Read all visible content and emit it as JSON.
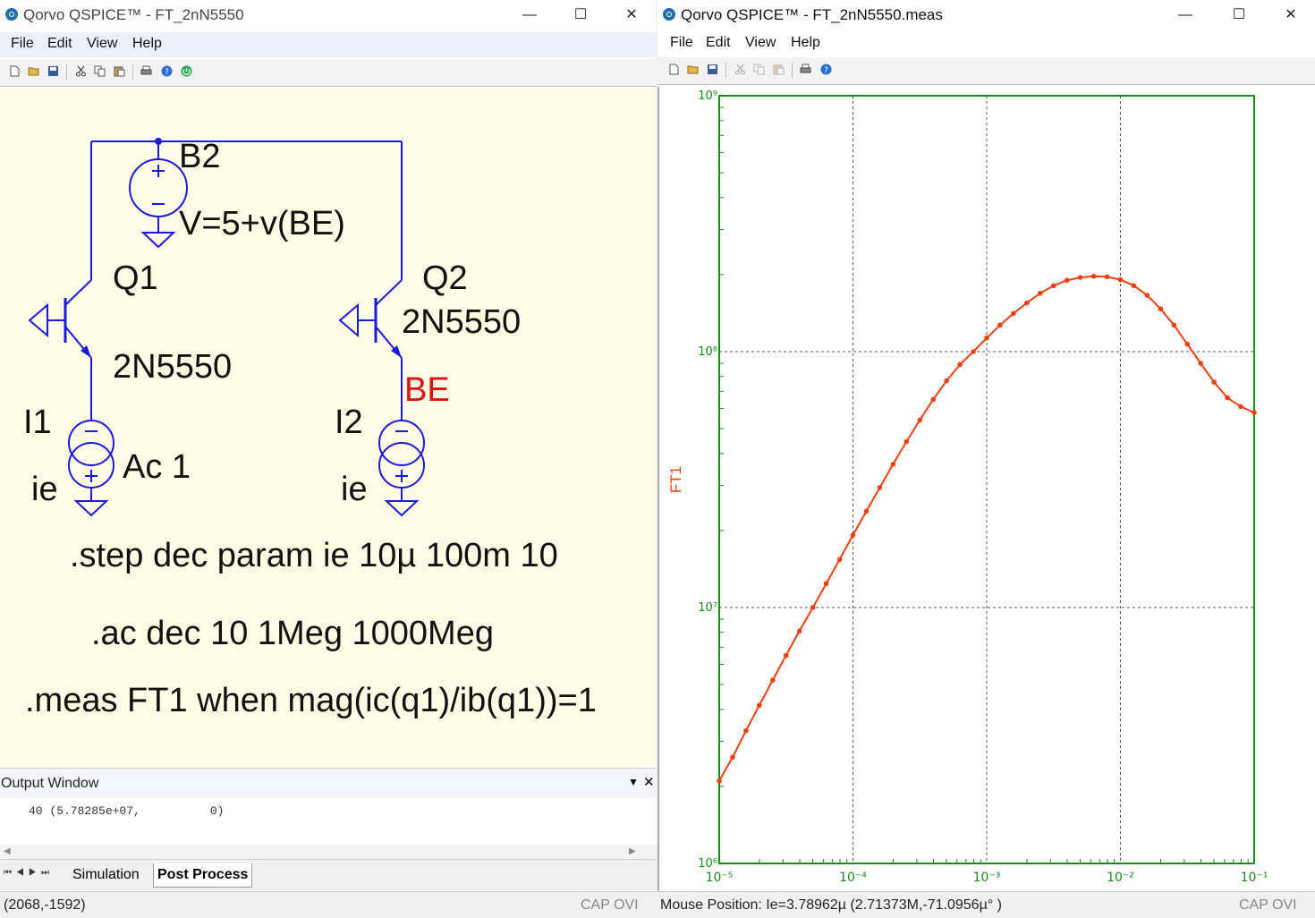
{
  "left_window": {
    "title": "Qorvo QSPICE™ - FT_2nN5550",
    "menu": [
      "File",
      "Edit",
      "View",
      "Help"
    ],
    "controls": {
      "minimize": "—",
      "maximize": "☐",
      "close": "✕"
    },
    "schematic": {
      "b2_name": "B2",
      "b2_value": "V=5+v(BE)",
      "q1_name": "Q1",
      "q1_model": "2N5550",
      "q2_name": "Q2",
      "q2_model": "2N5550",
      "net_label": "BE",
      "i1_name": "I1",
      "i1_param": "ie",
      "i1_ac": "Ac 1",
      "i2_name": "I2",
      "i2_param": "ie",
      "step_cmd": ".step dec param ie 10µ 100m 10",
      "ac_cmd": ".ac dec 10 1Meg 1000Meg",
      "meas_cmd": ".meas FT1 when mag(ic(q1)/ib(q1))=1"
    },
    "output_window": {
      "title": "Output Window",
      "line": "40 (5.78285e+07,          0)"
    },
    "tabs": [
      "Simulation",
      "Post Process"
    ],
    "active_tab": "Post Process",
    "status": "(2068,-1592)",
    "caps": "CAP OVI"
  },
  "right_window": {
    "title": "Qorvo QSPICE™ - FT_2nN5550.meas",
    "menu": [
      "File",
      "Edit",
      "View",
      "Help"
    ],
    "controls": {
      "minimize": "—",
      "maximize": "☐",
      "close": "✕"
    },
    "status": "Mouse Position: Ie=3.78962µ   (2.71373M,-71.0956µ° )",
    "caps": "CAP OVI"
  },
  "colors": {
    "wire": "#1a1adc",
    "schematic_bg": "#fffde6",
    "net_label": "#e01010",
    "axis": "#1a8a1a",
    "trace": "#f04010"
  },
  "chart_data": {
    "type": "line",
    "xlabel": "",
    "ylabel": "FT1",
    "x_scale": "log",
    "y_scale": "log",
    "xlim": [
      1e-05,
      0.1
    ],
    "ylim": [
      1000000.0,
      1000000000.0
    ],
    "x_tick_labels": [
      "10⁻⁵",
      "10⁻⁴",
      "10⁻³",
      "10⁻²",
      "10⁻¹"
    ],
    "y_tick_labels": [
      "10⁶",
      "10⁷",
      "10⁸",
      "10⁹"
    ],
    "grid": true,
    "series": [
      {
        "name": "FT1",
        "x": [
          1e-05,
          1.259e-05,
          1.585e-05,
          1.995e-05,
          2.512e-05,
          3.162e-05,
          3.981e-05,
          5.012e-05,
          6.31e-05,
          7.943e-05,
          0.0001,
          0.0001259,
          0.0001585,
          0.0001995,
          0.0002512,
          0.0003162,
          0.0003981,
          0.0005012,
          0.000631,
          0.0007943,
          0.001,
          0.001259,
          0.001585,
          0.001995,
          0.002512,
          0.003162,
          0.003981,
          0.005012,
          0.00631,
          0.007943,
          0.01,
          0.01259,
          0.01585,
          0.01995,
          0.02512,
          0.03162,
          0.03981,
          0.05012,
          0.0631,
          0.07943,
          0.1
        ],
        "y": [
          2100000.0,
          2600000.0,
          3300000.0,
          4150000.0,
          5200000.0,
          6500000.0,
          8100000.0,
          10000000.0,
          12400000.0,
          15400000.0,
          19200000.0,
          23800000.0,
          29400000.0,
          36300000.0,
          44500000.0,
          54000000.0,
          65000000.0,
          77000000.0,
          89000000.0,
          100000000.0,
          113000000.0,
          127000000.0,
          141000000.0,
          155000000.0,
          169000000.0,
          181000000.0,
          190000000.0,
          195000000.0,
          197000000.0,
          196000000.0,
          191000000.0,
          181000000.0,
          166000000.0,
          147000000.0,
          127000000.0,
          107000000.0,
          90000000.0,
          76000000.0,
          66000000.0,
          61000000.0,
          57800000.0
        ]
      }
    ]
  }
}
